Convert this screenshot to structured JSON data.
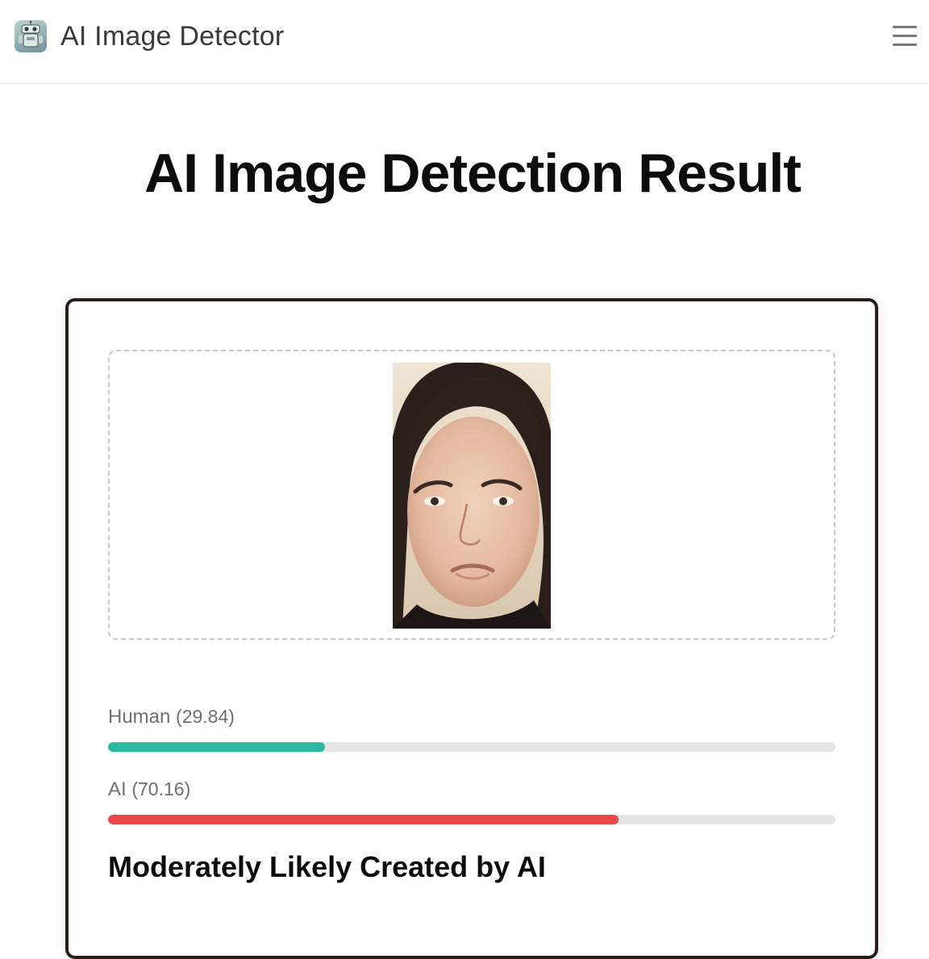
{
  "header": {
    "app_title": "AI Image Detector",
    "logo_icon": "robot-icon",
    "menu_icon": "hamburger-menu-icon"
  },
  "page": {
    "title": "AI Image Detection Result"
  },
  "result": {
    "image_icon": "face-photo",
    "human": {
      "label": "Human",
      "score": "(29.84)",
      "value": 29.84,
      "color": "#2cb8a3"
    },
    "ai": {
      "label": "AI",
      "score": "(70.16)",
      "value": 70.16,
      "color": "#e84848"
    },
    "verdict": "Moderately Likely Created by AI"
  },
  "colors": {
    "card_border": "#2b1f1c",
    "bar_track": "#e5e5e5"
  }
}
